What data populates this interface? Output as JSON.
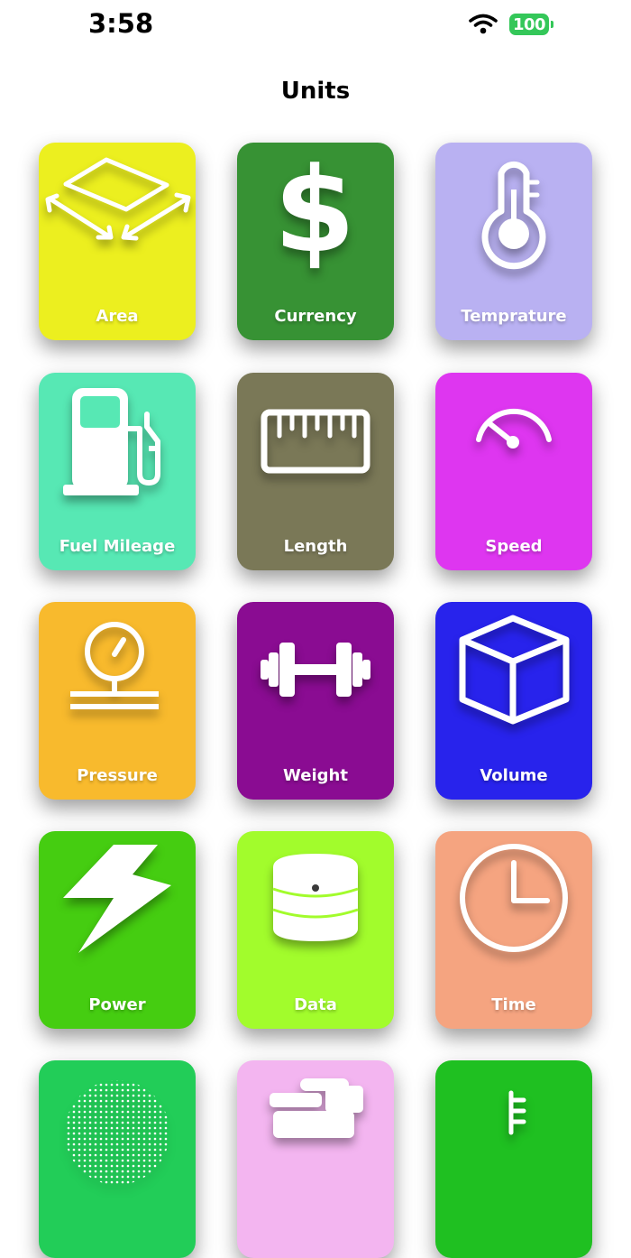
{
  "status_bar": {
    "time": "3:58",
    "battery_level": "100",
    "wifi_icon": "wifi-icon"
  },
  "nav": {
    "title": "Units"
  },
  "tiles": [
    {
      "label": "Area",
      "icon": "area-icon",
      "color": "#ecef1f"
    },
    {
      "label": "Currency",
      "icon": "dollar-icon",
      "color": "#379234"
    },
    {
      "label": "Temprature",
      "icon": "thermometer-icon",
      "color": "#b9b1f2"
    },
    {
      "label": "Fuel Mileage",
      "icon": "fuel-pump-icon",
      "color": "#57e8b4"
    },
    {
      "label": "Length",
      "icon": "ruler-icon",
      "color": "#7a7857"
    },
    {
      "label": "Speed",
      "icon": "speedometer-icon",
      "color": "#de36f0"
    },
    {
      "label": "Pressure",
      "icon": "pressure-gauge-icon",
      "color": "#f8ba2d"
    },
    {
      "label": "Weight",
      "icon": "dumbbell-icon",
      "color": "#8a0c92"
    },
    {
      "label": "Volume",
      "icon": "cube-icon",
      "color": "#2823ec"
    },
    {
      "label": "Power",
      "icon": "lightning-bolt-icon",
      "color": "#45cd11"
    },
    {
      "label": "Data",
      "icon": "database-icon",
      "color": "#a2fc2c"
    },
    {
      "label": "Time",
      "icon": "clock-icon",
      "color": "#f5a480"
    },
    {
      "label": "",
      "icon": "sphere-icon",
      "color": "#22cd58"
    },
    {
      "label": "",
      "icon": "stacked-items-icon",
      "color": "#f3b5f0"
    },
    {
      "label": "",
      "icon": "thermometer-scale-icon",
      "color": "#1fc021"
    }
  ]
}
